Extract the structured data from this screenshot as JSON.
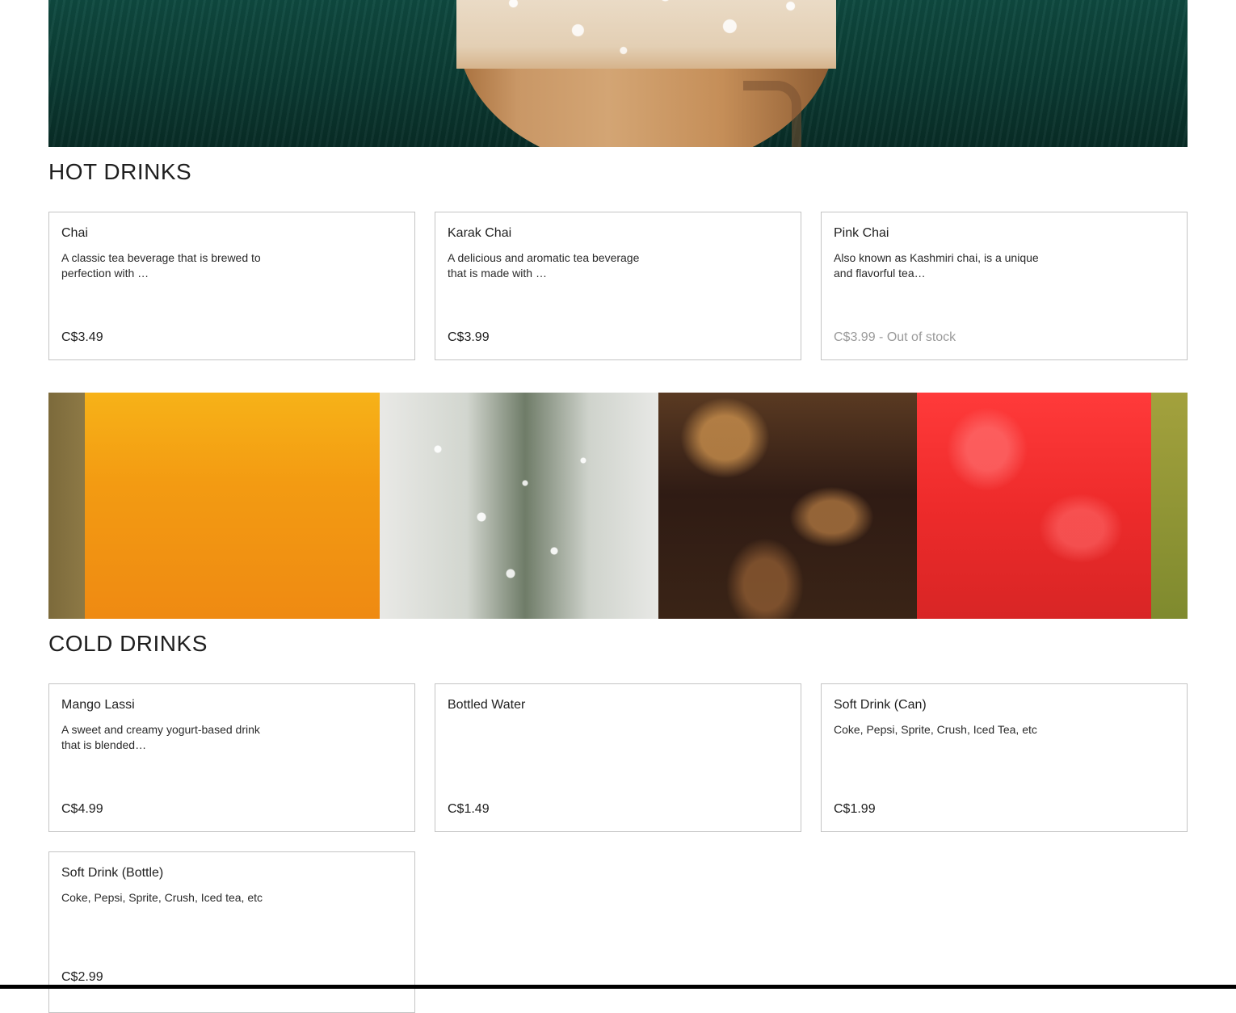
{
  "hot": {
    "title": "HOT DRINKS",
    "items": [
      {
        "name": "Chai",
        "description": "A classic tea beverage that is brewed to\nperfection with …",
        "price": "C$3.49"
      },
      {
        "name": "Karak Chai",
        "description": "A delicious and aromatic tea beverage\nthat is made with …",
        "price": "C$3.99"
      },
      {
        "name": "Pink Chai",
        "description": "Also known as Kashmiri chai, is a unique\nand flavorful tea…",
        "price": "C$3.99 - Out of stock"
      }
    ]
  },
  "cold": {
    "title": "COLD DRINKS",
    "items": [
      {
        "name": "Mango Lassi",
        "description": "A sweet and creamy yogurt-based drink\nthat is blended…",
        "price": "C$4.99"
      },
      {
        "name": "Bottled Water",
        "description": "",
        "price": "C$1.49"
      },
      {
        "name": "Soft Drink (Can)",
        "description": "Coke, Pepsi, Sprite, Crush, Iced Tea, etc",
        "price": "C$1.99"
      },
      {
        "name": "Soft Drink (Bottle)",
        "description": "Coke, Pepsi, Sprite, Crush, Iced tea, etc",
        "price": "C$2.99"
      }
    ]
  },
  "colors": {
    "border": "#c4c4c4",
    "text": "#1f1f1f",
    "muted": "#9a9a9a"
  }
}
